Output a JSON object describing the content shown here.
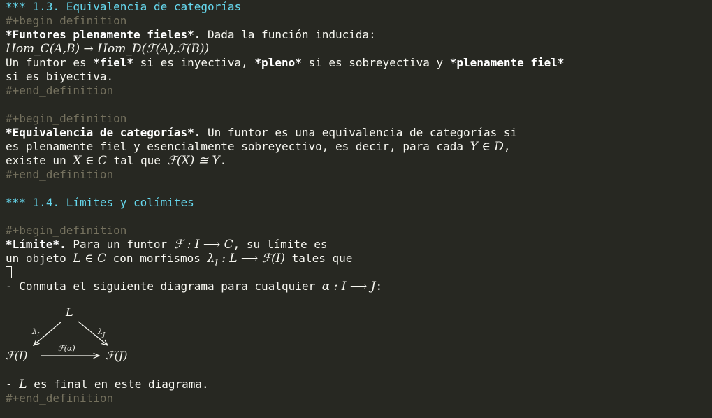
{
  "section_13": {
    "stars": "***",
    "title": "1.3. Equivalencia de categorías"
  },
  "def1": {
    "begin": "#+begin_definition",
    "bold_title": "*Funtores plenamente fieles*.",
    "intro": " Dada la función inducida:",
    "formula": "Hom_C(A,B) → Hom_D(ℱ(A),ℱ(B))",
    "l3a": "Un funtor es ",
    "fiel": "*fiel*",
    "l3b": " si es inyectiva, ",
    "pleno": "*pleno*",
    "l3c": " si es sobreyectiva y ",
    "plenamente_fiel": "*plenamente fiel*",
    "l4": "si es biyectiva.",
    "end": "#+end_definition"
  },
  "def2": {
    "begin": "#+begin_definition",
    "bold_title": "*Equivalencia de categorías*.",
    "l1": " Un funtor es una equivalencia de categorías si",
    "l2a": "es plenamente fiel y esencialmente sobreyectivo, es decir, para cada ",
    "m1": "Y ∈ D",
    "l2b": ",",
    "l3a": "existe un ",
    "m2": "X ∈ C",
    "l3b": " tal que ",
    "m3": "ℱ(X) ≅ Y",
    "l3c": ".",
    "end": "#+end_definition"
  },
  "section_14": {
    "stars": "***",
    "title": "1.4. Límites y colímites"
  },
  "def3": {
    "begin": "#+begin_definition",
    "bold_title": "*Límite*.",
    "l1a": " Para un funtor ",
    "m1": "ℱ : I ⟶ C",
    "l1b": ", su límite es",
    "l2a": "un objeto ",
    "m2": "L ∈ C",
    "l2b": " con morfismos ",
    "m3": "λ",
    "m3sub": "I",
    "m3rest": " : L ⟶ ℱ(I)",
    "l2c": " tales que",
    "item1a": "- Conmuta el siguiente diagrama para cualquier ",
    "m4": "α : I ⟶ J",
    "item1b": ":",
    "diagram": {
      "top": "L",
      "left_label": "λ",
      "left_label_sub": "I",
      "right_label": "λ",
      "right_label_sub": "J",
      "bottom_left": "ℱ(I)",
      "bottom_right": "ℱ(J)",
      "arrow_label": "ℱ(α)"
    },
    "item2a": "- ",
    "m5": "L",
    "item2b": " es final en este diagrama.",
    "end": "#+end_definition"
  }
}
